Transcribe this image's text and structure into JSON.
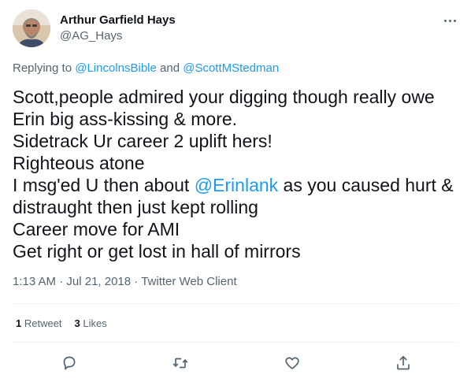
{
  "author": {
    "display_name": "Arthur Garfield Hays",
    "handle": "@AG_Hays",
    "avatar_icon": "avatar-photo"
  },
  "more_icon": "more-horizontal-icon",
  "replying": {
    "prefix": "Replying to ",
    "user1": "@LincolnsBible",
    "joiner": " and ",
    "user2": "@ScottMStedman"
  },
  "tweet": {
    "line1": "Scott,people admired your digging though really owe",
    "line2": "Erin big ass-kissing & more.",
    "line3": "Sidetrack Ur career 2 uplift hers!",
    "line4": "Righteous atone",
    "line5_prefix": "I msg'ed U then about ",
    "line5_mention": "@Erinlank",
    "line5_suffix": " as you caused hurt &",
    "line6": "distraught then just kept rolling",
    "line7": "Career move for AMI",
    "line8": "Get right or get lost in hall of mirrors"
  },
  "meta": {
    "time": "1:13 AM",
    "sep1": " · ",
    "date": "Jul 21, 2018",
    "sep2": " · ",
    "client": "Twitter Web Client"
  },
  "stats": {
    "retweets_count": "1",
    "retweets_label": " Retweet",
    "likes_count": "3",
    "likes_label": " Likes"
  },
  "actions": {
    "reply_icon": "reply-icon",
    "retweet_icon": "retweet-icon",
    "like_icon": "heart-icon",
    "share_icon": "share-icon"
  },
  "colors": {
    "link": "#1d9bf0",
    "secondary_text": "#536471",
    "primary_text": "#0f1419",
    "divider": "#eff3f4"
  }
}
